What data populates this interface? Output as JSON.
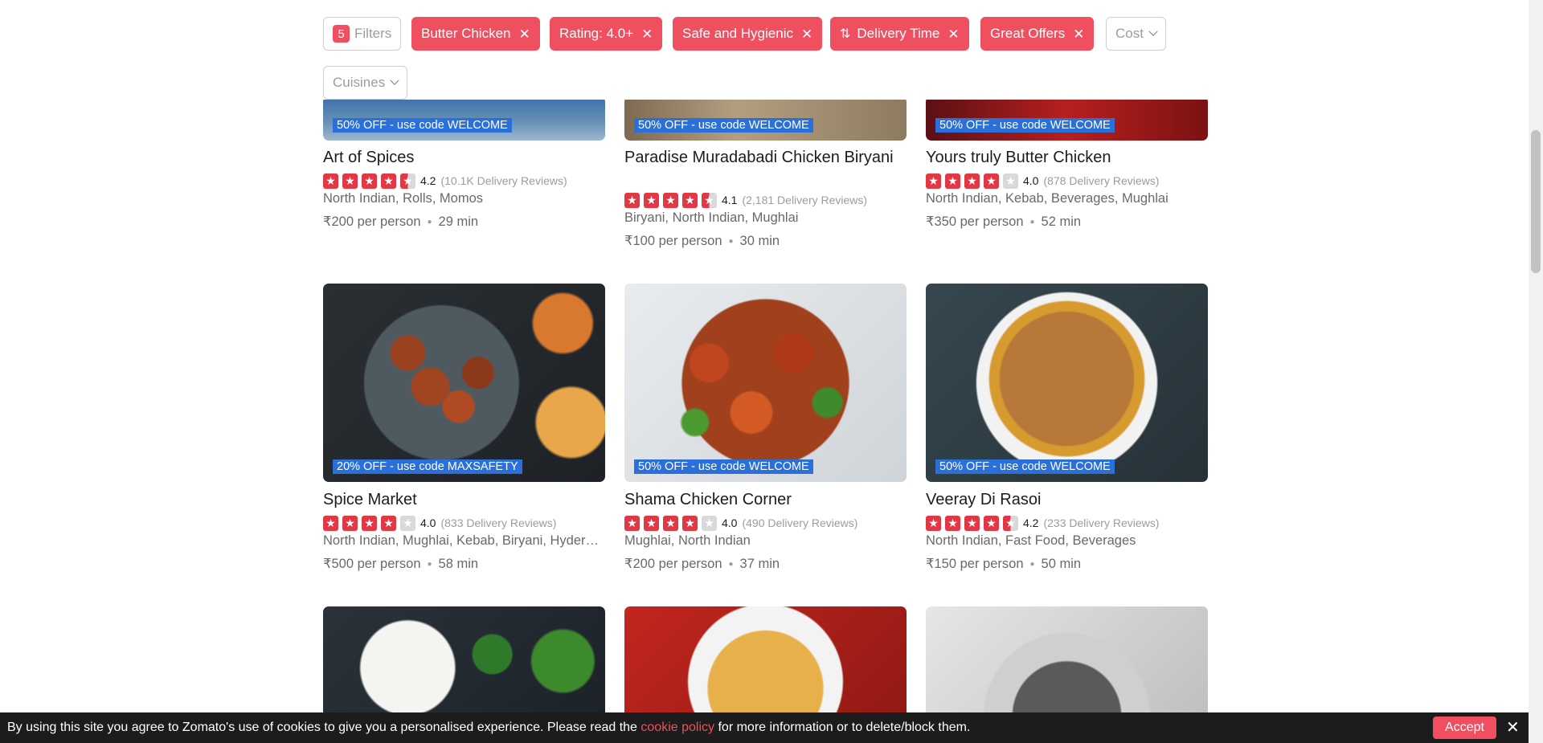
{
  "filters": {
    "filters_count": "5",
    "filters_label": "Filters",
    "active": [
      {
        "label": "Butter Chicken"
      },
      {
        "label": "Rating: 4.0+"
      },
      {
        "label": "Safe and Hygienic"
      },
      {
        "label": "Delivery Time"
      },
      {
        "label": "Great Offers"
      }
    ],
    "cost_label": "Cost",
    "cuisines_label": "Cuisines",
    "remove_glyph": "✕"
  },
  "restaurants": [
    {
      "name": "Art of Spices",
      "offer": "50% OFF - use code WELCOME",
      "rating": "4.2",
      "rating_value": 4.2,
      "reviews": "(10.1K Delivery Reviews)",
      "cuisines": "North Indian, Rolls, Momos",
      "cost": "₹200 per person",
      "time": "29 min"
    },
    {
      "name": "Paradise Muradabadi Chicken Biryani",
      "offer": "50% OFF - use code WELCOME",
      "rating": "4.1",
      "rating_value": 4.1,
      "reviews": "(2,181 Delivery Reviews)",
      "cuisines": "Biryani, North Indian, Mughlai",
      "cost": "₹100 per person",
      "time": "30 min"
    },
    {
      "name": "Yours truly Butter Chicken",
      "offer": "50% OFF - use code WELCOME",
      "rating": "4.0",
      "rating_value": 4.0,
      "reviews": "(878 Delivery Reviews)",
      "cuisines": "North Indian, Kebab, Beverages, Mughlai",
      "cost": "₹350 per person",
      "time": "52 min"
    },
    {
      "name": "Spice Market",
      "offer": "20% OFF - use code MAXSAFETY",
      "rating": "4.0",
      "rating_value": 4.0,
      "reviews": "(833 Delivery Reviews)",
      "cuisines": "North Indian, Mughlai, Kebab, Biryani, Hyder…",
      "cost": "₹500 per person",
      "time": "58 min"
    },
    {
      "name": "Shama Chicken Corner",
      "offer": "50% OFF - use code WELCOME",
      "rating": "4.0",
      "rating_value": 4.0,
      "reviews": "(490 Delivery Reviews)",
      "cuisines": "Mughlai, North Indian",
      "cost": "₹200 per person",
      "time": "37 min"
    },
    {
      "name": "Veeray Di Rasoi",
      "offer": "50% OFF - use code WELCOME",
      "rating": "4.2",
      "rating_value": 4.2,
      "reviews": "(233 Delivery Reviews)",
      "cuisines": "North Indian, Fast Food, Beverages",
      "cost": "₹150 per person",
      "time": "50 min"
    }
  ],
  "cookie": {
    "text_before": "By using this site you agree to Zomato's use of cookies to give you a personalised experience. Please read the",
    "link": "cookie policy",
    "text_after": "for more information or to delete/block them.",
    "accept": "Accept",
    "close": "✕"
  },
  "colors": {
    "brand": "#ef4f5f",
    "star": "#e23744",
    "offer_badge": "#2b6fd9",
    "cookie_bg": "#1c1c1c"
  },
  "icons": {
    "star": "star-icon",
    "sort": "sort-icon",
    "chevron": "chevron-down-icon",
    "close": "close-icon"
  }
}
